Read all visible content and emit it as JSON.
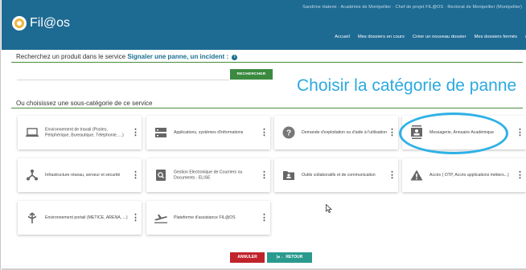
{
  "header": {
    "top_line": "Sandrine Hatemi · Académie de Montpellier · Chef de projet FIL@OS · Rectorat de Montpellier (Montpellier)",
    "app_name": "Fil@os",
    "nav": [
      "Accueil",
      "Mes dossiers en cours",
      "Créer un nouveau dossier",
      "Mes dossiers fermés",
      "("
    ]
  },
  "search": {
    "prefix": "Recherchez un produit dans le service",
    "service_link": "Signaler une panne, un incident :",
    "info_icon": "i",
    "input_value": "",
    "button_label": "RECHERCHER"
  },
  "annotation": "Choisir la catégorie de panne",
  "subcategory_title": "Ou choisissez une sous-catégorie de ce service",
  "cards": [
    {
      "label": "Environnement de travail (Postes, Périphérique, Bureautique, Téléphonie, ...)",
      "icon": "laptop-icon"
    },
    {
      "label": "Applications, systèmes d'informations",
      "icon": "server-icon"
    },
    {
      "label": "Demande d'exploitation ou d'aide à l'utilisation",
      "icon": "help-icon"
    },
    {
      "label": "Messagerie, Annuaire Académique",
      "icon": "contact-card-icon"
    },
    {
      "label": "Infrastructure réseau, serveur et sécurité",
      "icon": "network-icon"
    },
    {
      "label": "Gestion Electronique de Courriers ou Documents - ELISE",
      "icon": "document-search-icon"
    },
    {
      "label": "Outils collaboratifs et de communication",
      "icon": "folder-people-icon"
    },
    {
      "label": "Accès ( OTP, Accès applications métiers...)",
      "icon": "warning-icon"
    },
    {
      "label": "Environnement portail (METICE, ARENA, ...)",
      "icon": "signpost-icon"
    },
    {
      "label": "Plateforme d'assistance FIL@OS",
      "icon": "airplane-icon"
    }
  ],
  "footer": {
    "cancel_label": "ANNULER",
    "back_label": "|◂ ← RETOUR"
  },
  "colors": {
    "header": "#1d6a93",
    "rule": "#4a8c3a",
    "search_button": "#3b8a3f",
    "annotation": "#2ba9e0",
    "cancel": "#c0232a",
    "back": "#2a9a8f"
  }
}
